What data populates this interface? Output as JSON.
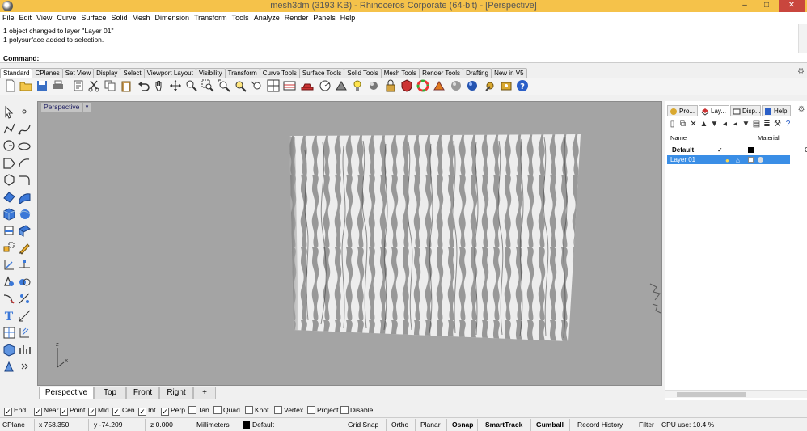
{
  "window": {
    "title": "mesh3dm (3193 KB) - Rhinoceros Corporate (64-bit) - [Perspective]",
    "minimize": "–",
    "maximize": "□",
    "close": "✕"
  },
  "menu": [
    "File",
    "Edit",
    "View",
    "Curve",
    "Surface",
    "Solid",
    "Mesh",
    "Dimension",
    "Transform",
    "Tools",
    "Analyze",
    "Render",
    "Panels",
    "Help"
  ],
  "command_history": [
    "1 object changed to layer \"Layer 01\"",
    "1 polysurface added to selection."
  ],
  "command_prompt": "Command:",
  "toolbar_tabs": [
    "Standard",
    "CPlanes",
    "Set View",
    "Display",
    "Select",
    "Viewport Layout",
    "Visibility",
    "Transform",
    "Curve Tools",
    "Surface Tools",
    "Solid Tools",
    "Mesh Tools",
    "Render Tools",
    "Drafting",
    "New in V5"
  ],
  "viewport": {
    "label": "Perspective",
    "menu_arrow": "▾",
    "axis_x": "x",
    "axis_z": "z"
  },
  "viewport_tabs": [
    "Perspective",
    "Top",
    "Front",
    "Right",
    "+"
  ],
  "panel": {
    "tabs": [
      "Pro...",
      "Lay...",
      "Disp...",
      "Help"
    ],
    "columns": [
      "Name",
      "Material"
    ],
    "layers": [
      {
        "name": "Default",
        "current": "✓",
        "color": "#000000",
        "selected": false,
        "extra": "C"
      },
      {
        "name": "Layer 01",
        "current": "",
        "color": "#ffffff",
        "selected": true,
        "extra": ""
      }
    ]
  },
  "osnaps": [
    {
      "label": "End",
      "checked": true
    },
    {
      "label": "Near",
      "checked": true
    },
    {
      "label": "Point",
      "checked": true
    },
    {
      "label": "Mid",
      "checked": true
    },
    {
      "label": "Cen",
      "checked": true
    },
    {
      "label": "Int",
      "checked": true
    },
    {
      "label": "Perp",
      "checked": true
    },
    {
      "label": "Tan",
      "checked": false
    },
    {
      "label": "Quad",
      "checked": false
    },
    {
      "label": "Knot",
      "checked": false
    },
    {
      "label": "Vertex",
      "checked": false
    },
    {
      "label": "Project",
      "checked": false
    },
    {
      "label": "Disable",
      "checked": false
    }
  ],
  "status": {
    "cplane": "CPlane",
    "x": "x 758.350",
    "y": "y -74.209",
    "z": "z 0.000",
    "units": "Millimeters",
    "layer": "Default",
    "grid_snap": "Grid Snap",
    "ortho": "Ortho",
    "planar": "Planar",
    "osnap": "Osnap",
    "smarttrack": "SmartTrack",
    "gumball": "Gumball",
    "record_history": "Record History",
    "filter": "Filter",
    "cpu": "CPU use: 10.4 %"
  },
  "colors": {
    "titlebar": "#f5c24a",
    "viewport_bg": "#a4a4a4",
    "panel_selected_row": "#3a8ee6",
    "close_button": "#c9463d"
  }
}
